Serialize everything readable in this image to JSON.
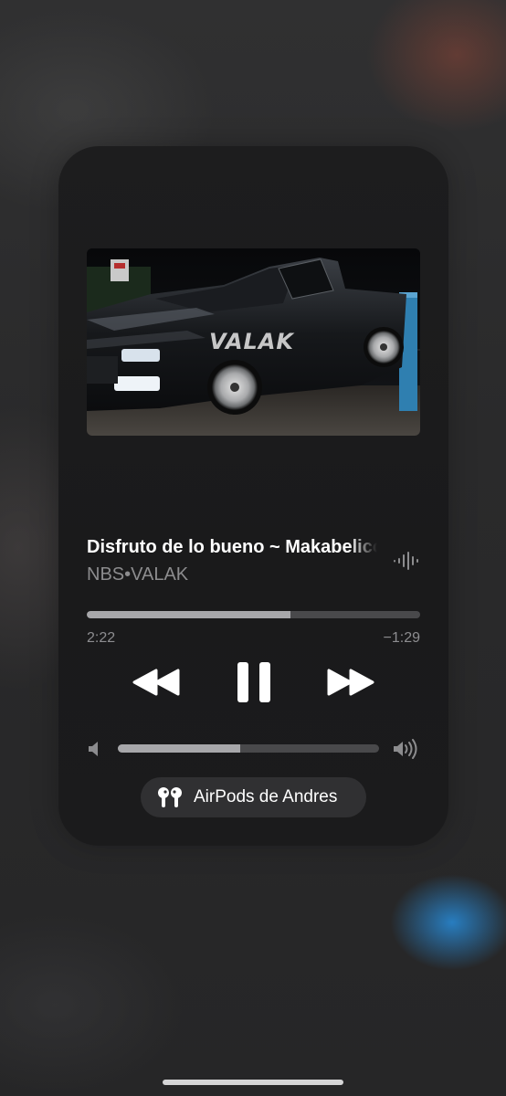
{
  "now_playing": {
    "title": "Disfruto de lo bueno ~ Makabelico",
    "artist": "NBS•VALAK",
    "artwork_text": "VALAK",
    "elapsed": "2:22",
    "remaining": "−1:29",
    "progress_fraction": 0.61
  },
  "volume": {
    "level_fraction": 0.47
  },
  "output": {
    "device_label": "AirPods de Andres"
  },
  "colors": {
    "card_background": "#1c1c1d",
    "track_empty": "#49494b",
    "track_fill": "#a7a7aa",
    "secondary_text": "#8c8c8e",
    "pill_background": "#303032"
  },
  "icons": {
    "waveform": "waveform-icon",
    "rewind": "backward-icon",
    "pause": "pause-icon",
    "forward": "forward-icon",
    "speaker_low": "speaker-low-icon",
    "speaker_high": "speaker-high-icon",
    "airpods": "airpods-icon"
  }
}
